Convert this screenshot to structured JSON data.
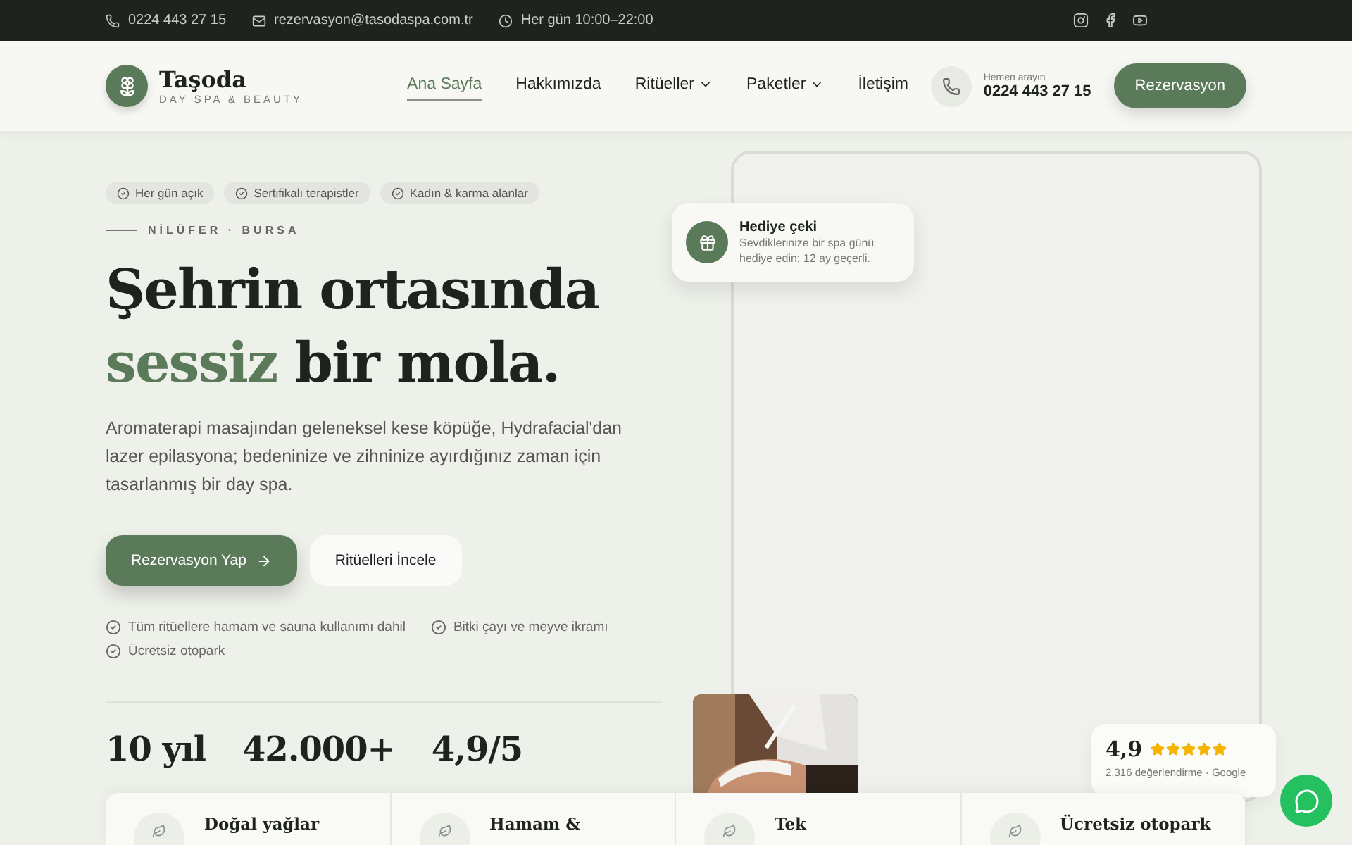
{
  "topbar": {
    "contacts": [
      {
        "kind": "phone",
        "text": "0224 443 27 15"
      },
      {
        "kind": "mail",
        "text": "rezervasyon@tasodaspa.com.tr"
      },
      {
        "kind": "clock",
        "text": "Her gün 10:00–22:00"
      }
    ]
  },
  "header": {
    "brand": {
      "name": "Taşoda",
      "tagline": "DAY SPA & BEAUTY"
    },
    "nav": [
      {
        "label": "Ana Sayfa",
        "selected": true,
        "dropdown": false
      },
      {
        "label": "Hakkımızda",
        "selected": false,
        "dropdown": false
      },
      {
        "label": "Ritüeller",
        "selected": false,
        "dropdown": true
      },
      {
        "label": "Paketler",
        "selected": false,
        "dropdown": true
      },
      {
        "label": "İletişim",
        "selected": false,
        "dropdown": false
      }
    ],
    "call": {
      "hint": "Hemen arayın",
      "number": "0224 443 27 15"
    },
    "cta": "Rezervasyon"
  },
  "hero": {
    "badges": [
      "Her gün açık",
      "Sertifikalı terapistler",
      "Kadın & karma alanlar"
    ],
    "eyebrow": "NİLÜFER · BURSA",
    "headline": {
      "line1": "Şehrin ortasında",
      "accent": "sessiz",
      "rest": "bir mola."
    },
    "lead": "Aromaterapi masajından geleneksel kese köpüğe, Hydrafacial'dan lazer epilasyona; bedeninize ve zihninize ayırdığınız zaman için tasarlanmış bir day spa.",
    "primary": "Rezervasyon Yap",
    "secondary": "Ritüelleri İncele",
    "perks": [
      "Tüm ritüellere hamam ve sauna kullanımı dahil",
      "Bitki çayı ve meyve ikramı",
      "Ücretsiz otopark"
    ],
    "stats": [
      "10 yıl",
      "42.000+",
      "4,9/5"
    ]
  },
  "gift": {
    "title": "Hediye çeki",
    "text": "Sevdiklerinize bir spa günü hediye edin; 12 ay geçerli."
  },
  "rating": {
    "score": "4,9",
    "stars": 5,
    "text": "2.316 değerlendirme · Google"
  },
  "features": [
    "Doğal yağlar",
    "Hamam &",
    "Tek",
    "Ücretsiz otopark"
  ]
}
